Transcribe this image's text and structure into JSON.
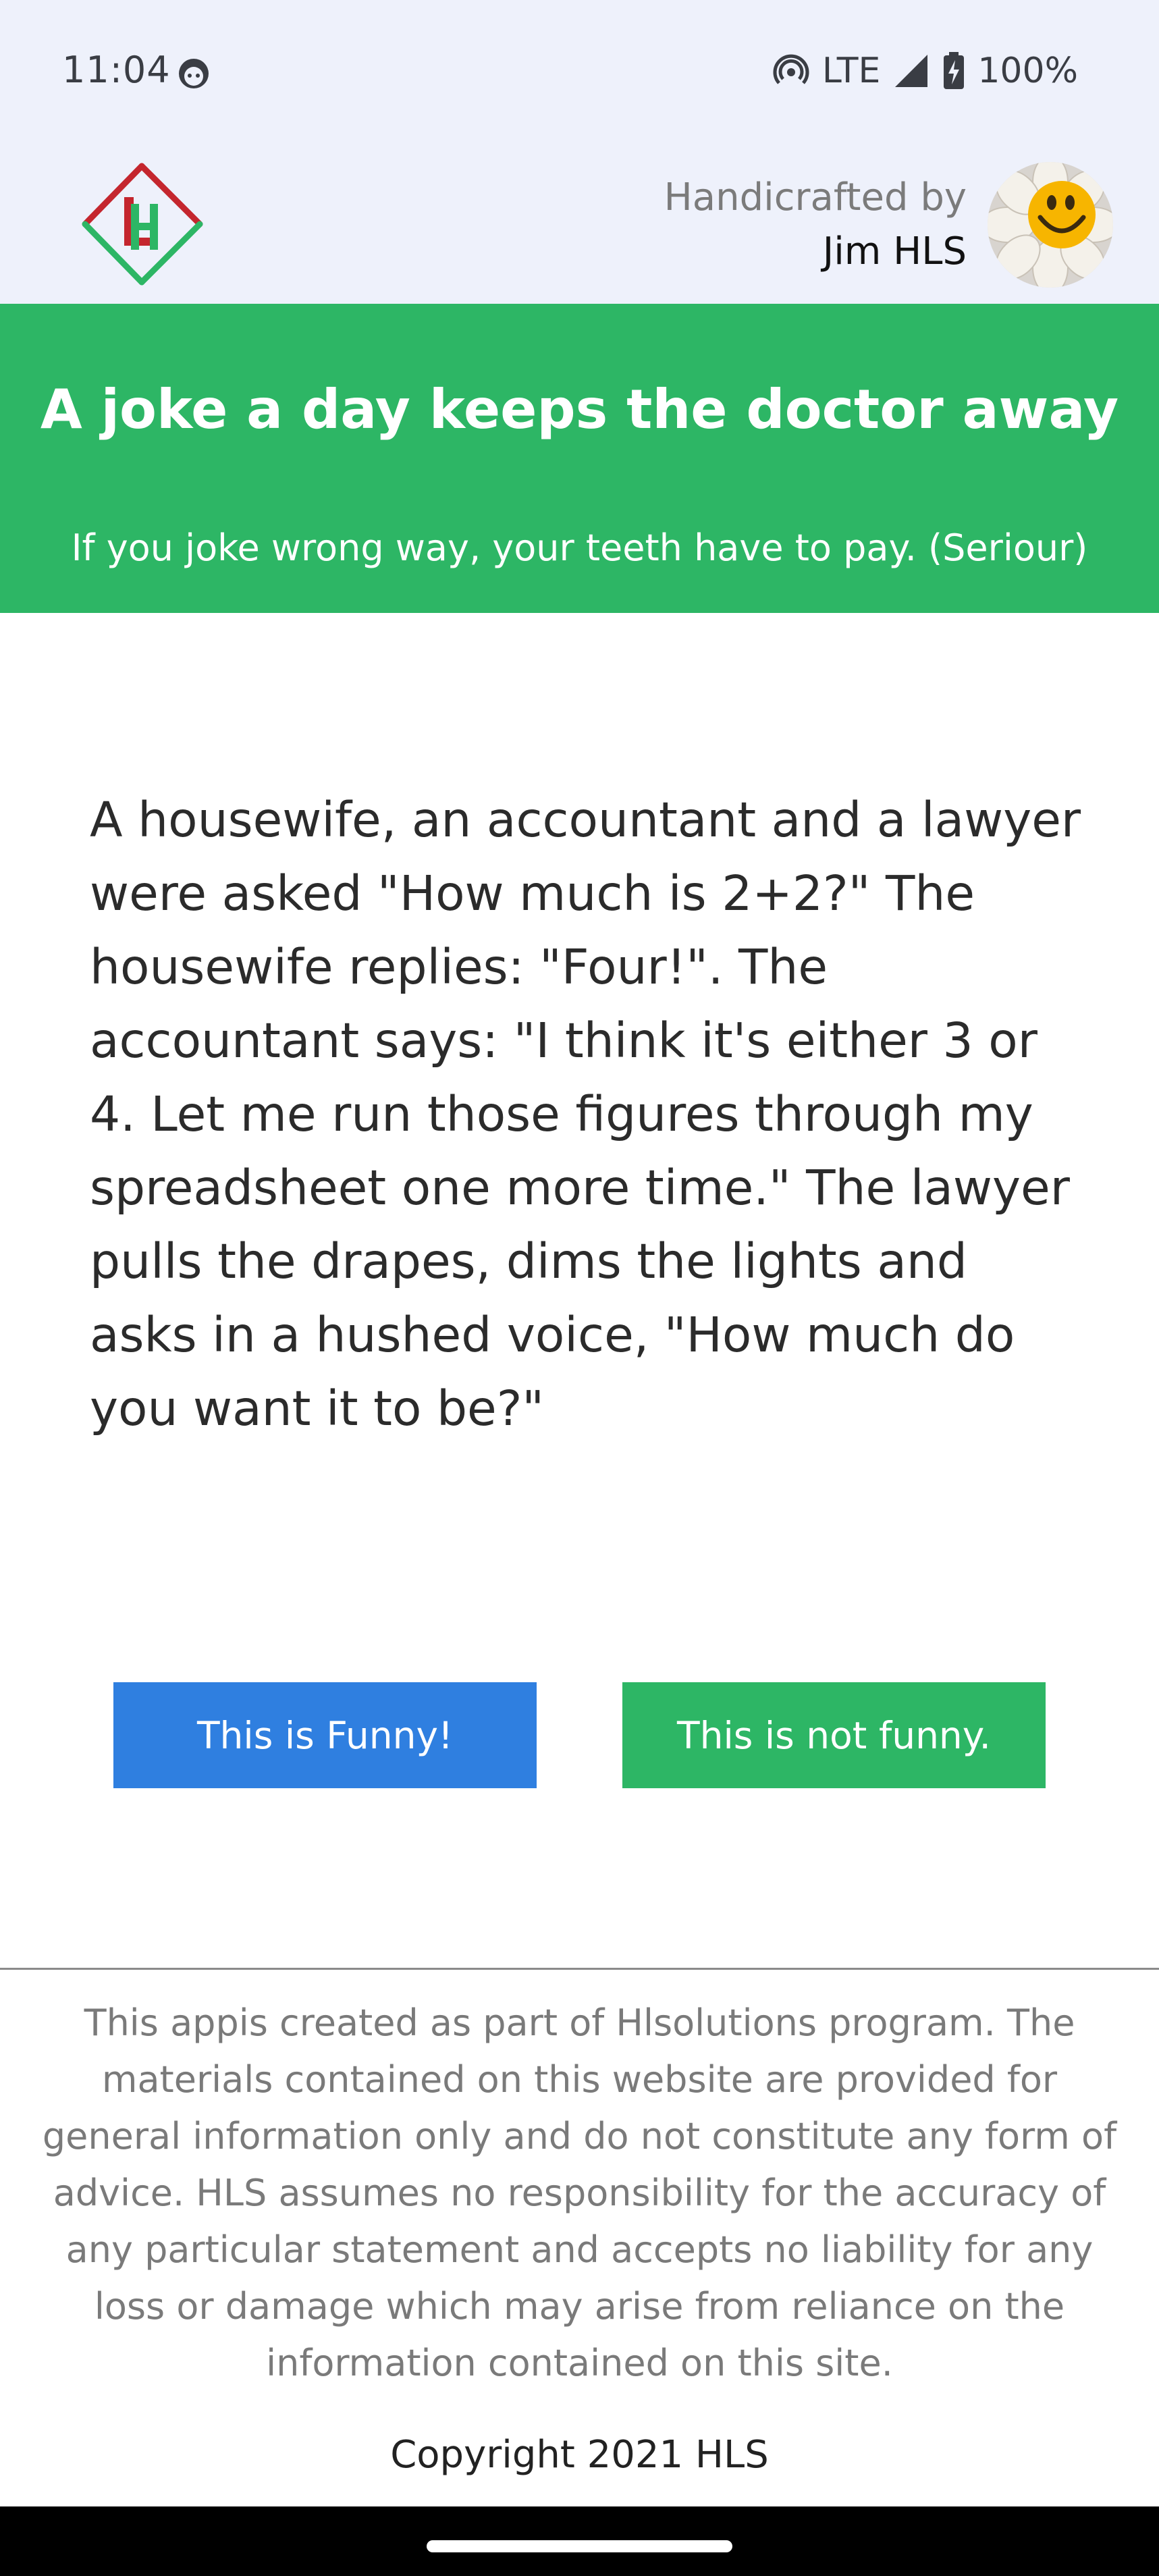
{
  "status_bar": {
    "time": "11:04",
    "network": "LTE",
    "battery": "100%",
    "icons": [
      "face-icon",
      "hotspot-icon",
      "signal-icon",
      "battery-charging-icon"
    ]
  },
  "header": {
    "logo_icon": "hl-diamond-logo",
    "credit_line1": "Handicrafted by",
    "credit_line2": "Jim HLS",
    "avatar_icon": "smiley-flower-avatar"
  },
  "banner": {
    "title": "A joke a day keeps the doctor away",
    "subtitle": "If you joke wrong way, your teeth have to pay. (Seriour)",
    "color": "#2db665"
  },
  "joke": {
    "text": "A housewife, an accountant and a lawyer were asked \"How much is 2+2?\" The housewife replies: \"Four!\". The accountant says: \"I think it's either 3 or 4. Let me run those figures through my spreadsheet one more time.\" The lawyer pulls the drapes, dims the lights and asks in a hushed voice, \"How much do you want it to be?\""
  },
  "buttons": {
    "funny_label": "This is Funny!",
    "funny_color": "#2f7fe0",
    "not_funny_label": "This is not funny.",
    "not_funny_color": "#2db665"
  },
  "footer": {
    "disclaimer": "This appis created as part of Hlsolutions program. The materials contained on this website are provided for general information only and do not constitute any form of advice. HLS assumes no responsibility for the accuracy of any particular statement and accepts no liability for any loss or damage which may arise from reliance on the information contained on this site.",
    "copyright": "Copyright 2021 HLS"
  }
}
